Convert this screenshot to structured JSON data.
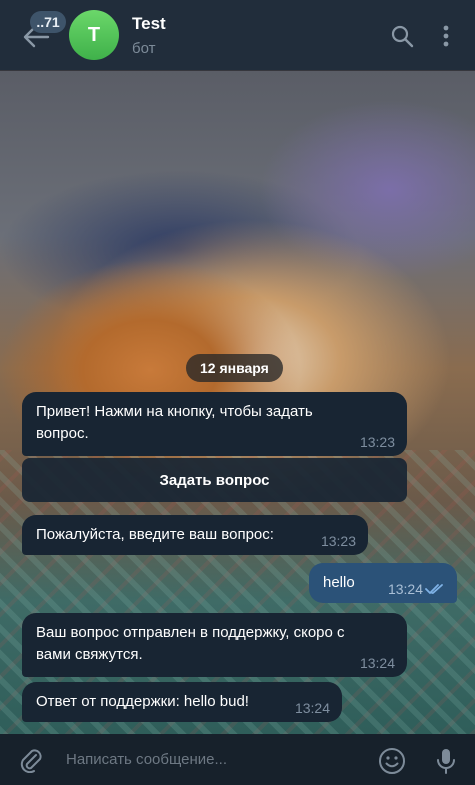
{
  "header": {
    "unread_count": "..71",
    "avatar_letter": "T",
    "title": "Test",
    "subtitle": "бот"
  },
  "chat": {
    "date": "12 января",
    "messages": [
      {
        "direction": "in",
        "text": "Привет! Нажми на кнопку, чтобы задать вопрос.",
        "time": "13:23"
      },
      {
        "direction": "in",
        "text": "Пожалуйста, введите ваш вопрос:",
        "time": "13:23"
      },
      {
        "direction": "out",
        "text": "hello",
        "time": "13:24",
        "read": true
      },
      {
        "direction": "in",
        "text": "Ваш вопрос отправлен в поддержку, скоро с вами свяжутся.",
        "time": "13:24"
      },
      {
        "direction": "in",
        "text": "Ответ от поддержки: hello bud!",
        "time": "13:24"
      }
    ],
    "keyboard_button": "Задать вопрос"
  },
  "input": {
    "placeholder": "Написать сообщение..."
  },
  "icons": {
    "back": "arrow-left-icon",
    "search": "search-icon",
    "menu": "more-vertical-icon",
    "attach": "paperclip-icon",
    "emoji": "smile-icon",
    "voice": "microphone-icon"
  },
  "colors": {
    "header_bg": "#212d3b",
    "incoming_bubble": "#182533",
    "outgoing_bubble": "#2b5278",
    "avatar": "#4cc04f",
    "input_bg": "#17212b"
  }
}
